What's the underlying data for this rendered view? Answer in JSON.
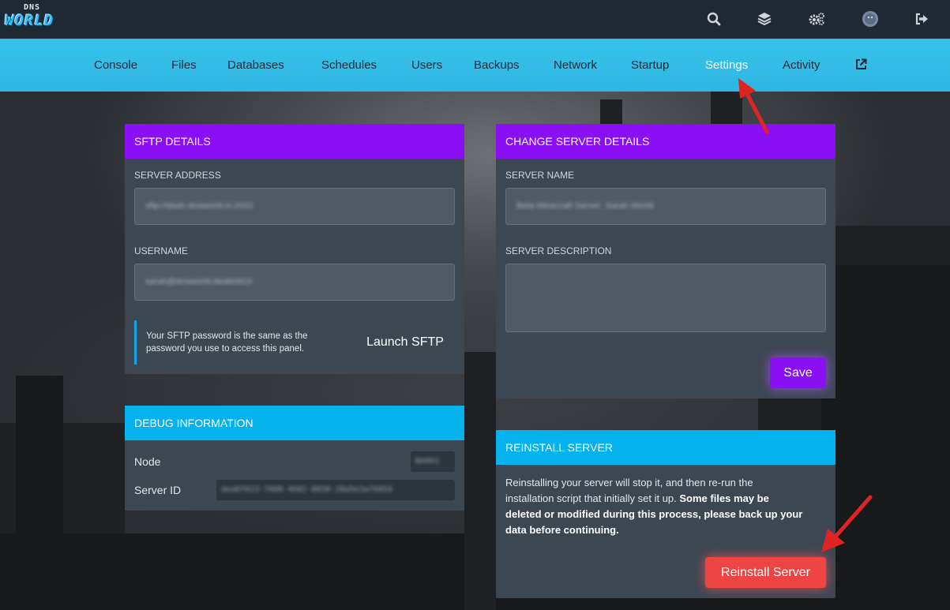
{
  "brand": {
    "logo_top": "DNS",
    "logo_main": "WORLD"
  },
  "topbar": {
    "icons": [
      "search-icon",
      "layers-icon",
      "cogs-icon",
      "avatar",
      "sign-out-icon"
    ]
  },
  "nav": {
    "items": [
      {
        "label": "Console"
      },
      {
        "label": "Files"
      },
      {
        "label": "Databases"
      },
      {
        "label": "Schedules"
      },
      {
        "label": "Users"
      },
      {
        "label": "Backups"
      },
      {
        "label": "Network"
      },
      {
        "label": "Startup"
      },
      {
        "label": "Settings"
      },
      {
        "label": "Activity"
      }
    ],
    "active": "Settings",
    "external_icon": "external-link-icon"
  },
  "sftp": {
    "title": "SFTP DETAILS",
    "address_label": "SERVER ADDRESS",
    "address_value": "sftp://dash.dnsworld.io:2022",
    "username_label": "USERNAME",
    "username_value": "sarah@dnsworld.deab0923",
    "note_line1": "Your SFTP password is the same as the",
    "note_line2": "password you use to access this panel.",
    "launch_label": "Launch SFTP"
  },
  "debug": {
    "title": "DEBUG INFORMATION",
    "node_label": "Node",
    "node_value": "NA001",
    "server_id_label": "Server ID",
    "server_id_value": "dea8f023-7088-4682-8838-28a5e3a7685d"
  },
  "server_details": {
    "title": "CHANGE SERVER DETAILS",
    "name_label": "SERVER NAME",
    "name_value": "Beta Minecraft Server: Sarah World",
    "description_label": "SERVER DESCRIPTION",
    "description_value": "",
    "save_label": "Save"
  },
  "reinstall": {
    "title": "REINSTALL SERVER",
    "text_line1": "Reinstalling your server will stop it, and then re-run the",
    "text_line2_plain": "installation script that initially set it up. ",
    "text_line2_bold": "Some files may be",
    "text_line3_bold": "deleted or modified during this process, please back up your",
    "text_line4_bold": "data before continuing.",
    "button_label": "Reinstall Server"
  },
  "colors": {
    "topbar": "#1f2933",
    "nav": "#36c3ea",
    "panel": "#3d4752",
    "purple_header": "#8a0ff5",
    "blue_header": "#05b2ee",
    "danger": "#ef4444",
    "annotation_arrow": "#e02424"
  }
}
